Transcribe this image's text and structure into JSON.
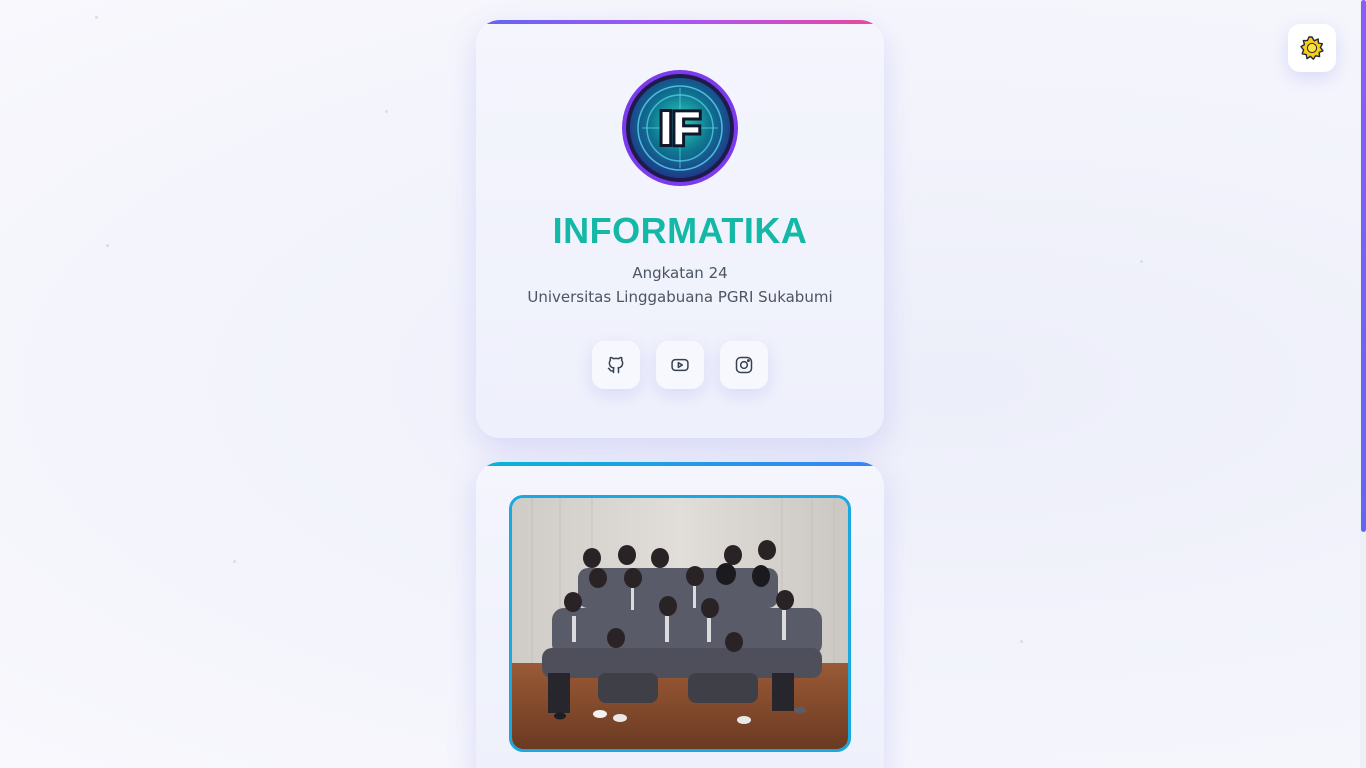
{
  "profile": {
    "logo_text": "IF",
    "title": "INFORMATIKA",
    "subtitle_1": "Angkatan 24",
    "subtitle_2": "Universitas Linggabuana PGRI Sukabumi"
  },
  "social": [
    {
      "icon": "github-icon"
    },
    {
      "icon": "youtube-icon"
    },
    {
      "icon": "instagram-icon"
    }
  ],
  "theme_toggle": {
    "icon": "sun-icon"
  },
  "photo": {
    "description_icon": "group-photo"
  },
  "colors": {
    "accent_teal": "#14b8a6",
    "accent_purple": "#8b5cf6",
    "photo_border": "#1aa8e0"
  }
}
